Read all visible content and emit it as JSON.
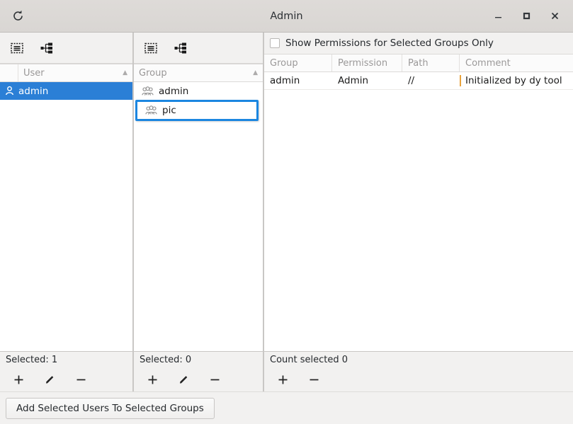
{
  "window": {
    "title": "Admin",
    "refresh_icon": "refresh-icon",
    "minimize_label": "–",
    "maximize_label": "☐",
    "close_label": "✕"
  },
  "user_pane": {
    "toolbar": [
      {
        "icon": "select-all-icon",
        "name": "select-all-users-button"
      },
      {
        "icon": "hierarchy-icon",
        "name": "user-hierarchy-button"
      }
    ],
    "columns": [
      "",
      "User"
    ],
    "header_user": "User",
    "sort_caret": "▲",
    "rows": [
      {
        "icon": "user-icon",
        "label": "admin",
        "selected": true
      }
    ],
    "status": "Selected: 1",
    "actions": [
      {
        "name": "add-user-button",
        "glyph": "+"
      },
      {
        "name": "edit-user-button",
        "glyph": "✎"
      },
      {
        "name": "remove-user-button",
        "glyph": "−"
      }
    ]
  },
  "group_pane": {
    "toolbar": [
      {
        "icon": "select-all-icon",
        "name": "select-all-groups-button"
      },
      {
        "icon": "hierarchy-icon",
        "name": "group-hierarchy-button"
      }
    ],
    "header_group": "Group",
    "sort_caret": "▲",
    "rows": [
      {
        "icon": "group-icon",
        "label": "admin",
        "focused": false
      },
      {
        "icon": "group-icon",
        "label": "pic",
        "focused": true
      }
    ],
    "status": "Selected: 0",
    "actions": [
      {
        "name": "add-group-button",
        "glyph": "+"
      },
      {
        "name": "edit-group-button",
        "glyph": "✎"
      },
      {
        "name": "remove-group-button",
        "glyph": "−"
      }
    ]
  },
  "permission_pane": {
    "checkbox_label": "Show Permissions for Selected Groups Only",
    "checkbox_checked": false,
    "columns": [
      "Group",
      "Permission",
      "Path",
      "Comment"
    ],
    "col_group": "Group",
    "col_permission": "Permission",
    "col_path": "Path",
    "col_comment": "Comment",
    "rows": [
      {
        "group": "admin",
        "permission": "Admin",
        "path": "//",
        "comment": "Initialized by dy tool"
      }
    ],
    "status": "Count selected 0",
    "actions": [
      {
        "name": "add-permission-button",
        "glyph": "+"
      },
      {
        "name": "remove-permission-button",
        "glyph": "−"
      }
    ]
  },
  "bottom": {
    "add_users_to_groups_label": "Add Selected Users To Selected Groups"
  },
  "colors": {
    "selection_blue": "#2b7fd6",
    "focus_blue": "#1b86e0",
    "cursor_amber": "#e8a33d",
    "chrome_bg": "#f2f1f0",
    "titlebar_bg": "#dedbd8"
  }
}
